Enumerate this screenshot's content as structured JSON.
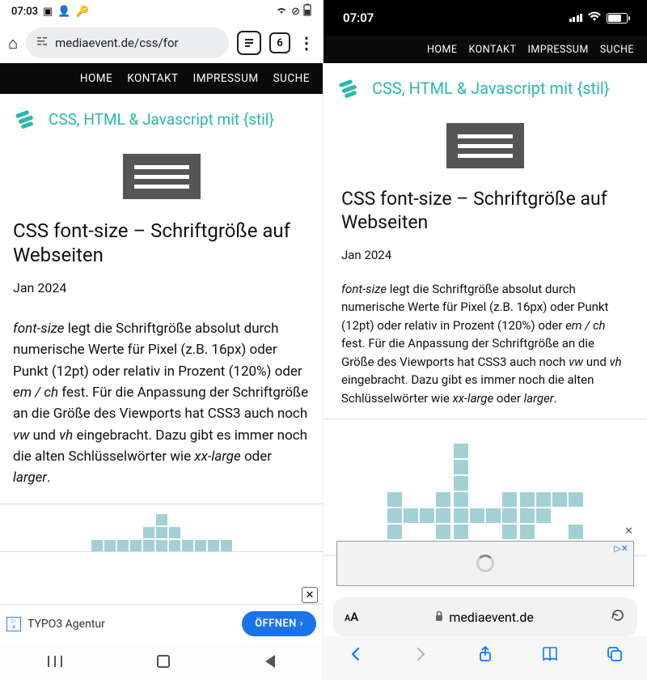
{
  "left": {
    "status_time": "07:03",
    "status_icons": [
      "image-icon",
      "person-icon",
      "key-icon"
    ],
    "url": "mediaevent.de/css/for",
    "tab_count": "6",
    "nav": [
      "HOME",
      "KONTAKT",
      "IMPRESSUM",
      "SUCHE"
    ],
    "brand": "CSS, HTML & Javascript mit {stil}",
    "h1": "CSS font-size – Schriftgröße auf Webseiten",
    "date": "Jan 2024",
    "p_1": "font-size",
    "p_2": " legt die Schriftgröße absolut durch numerische Werte für Pixel (z.B. 16px) oder Punkt (12pt) oder relativ in Prozent (120%) oder ",
    "p_3": "em / ch",
    "p_4": " fest. Für die Anpassung der Schriftgröße an die Größe des Viewports hat CSS3 auch noch ",
    "p_5": "vw",
    "p_6": " und ",
    "p_7": "vh",
    "p_8": " eingebracht. Dazu gibt es immer noch die alten Schlüsselwörter wie ",
    "p_9": "xx-large",
    "p_10": " oder ",
    "p_11": "larger",
    "p_12": ".",
    "ad_text": "TYPO3 Agentur",
    "ad_button": "ÖFFNEN"
  },
  "right": {
    "status_time": "07:07",
    "nav": [
      "HOME",
      "KONTAKT",
      "IMPRESSUM",
      "SUCHE"
    ],
    "brand": "CSS, HTML & Javascript mit {stil}",
    "h1": "CSS font-size – Schriftgröße auf Webseiten",
    "date": "Jan 2024",
    "p_1": "font-size",
    "p_2": " legt die Schriftgröße absolut durch numerische Werte für Pixel (z.B. 16px) oder Punkt (12pt) oder relativ in Prozent (120%) oder ",
    "p_3": "em / ch",
    "p_4": " fest. Für die Anpassung der Schriftgröße an die Größe des Viewports hat CSS3 auch noch ",
    "p_5": "vw",
    "p_6": " und ",
    "p_7": "vh",
    "p_8": " eingebracht. Dazu gibt es immer noch die alten Schlüsselwörter wie ",
    "p_9": "xx-large",
    "p_10": " oder ",
    "p_11": "larger",
    "p_12": ".",
    "domain": "mediaevent.de",
    "adchoices": "▷✕"
  }
}
